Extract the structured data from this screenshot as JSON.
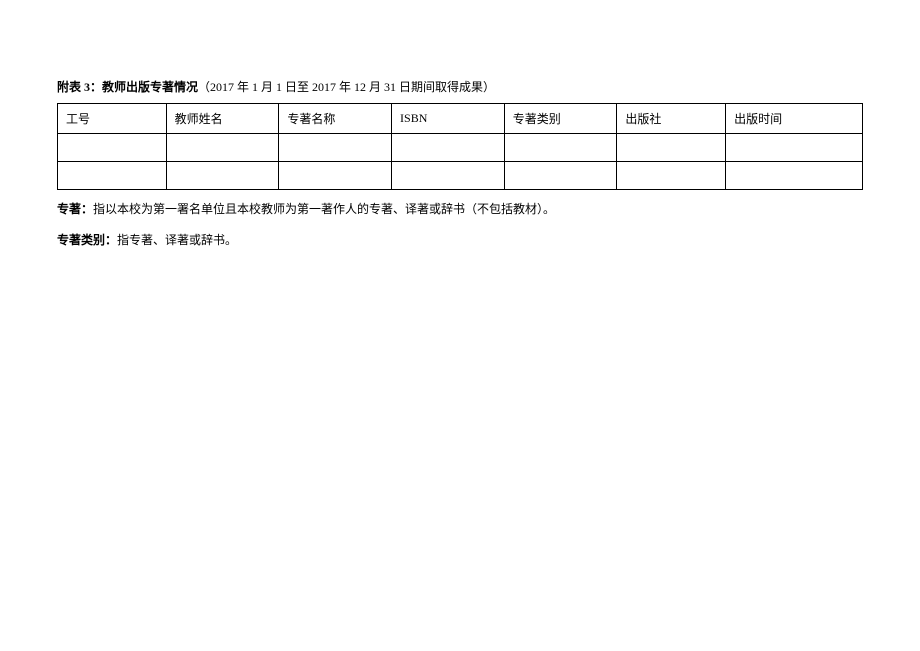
{
  "title": {
    "label": "附表 3：教师出版专著情况",
    "note": "（2017 年 1 月 1 日至 2017 年 12 月 31 日期间取得成果）"
  },
  "table": {
    "headers": [
      "工号",
      "教师姓名",
      "专著名称",
      "ISBN",
      "专著类别",
      "出版社",
      "出版时间"
    ],
    "rows": [
      [
        "",
        "",
        "",
        "",
        "",
        "",
        ""
      ],
      [
        "",
        "",
        "",
        "",
        "",
        "",
        ""
      ]
    ]
  },
  "notes": [
    {
      "label": "专著：",
      "text": "指以本校为第一署名单位且本校教师为第一著作人的专著、译著或辞书（不包括教材）。"
    },
    {
      "label": "专著类别：",
      "text": "指专著、译著或辞书。"
    }
  ]
}
